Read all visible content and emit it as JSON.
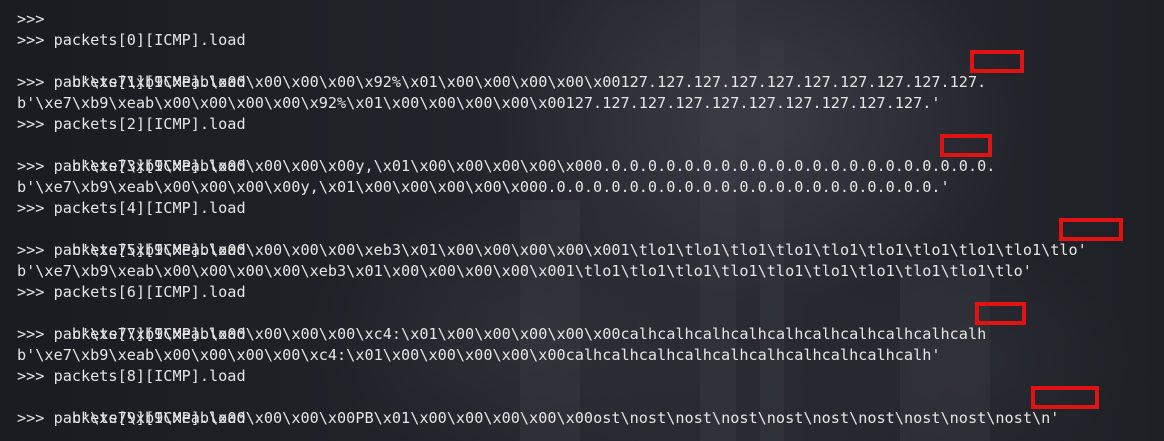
{
  "terminal": {
    "lines": [
      {
        "kind": "prompt",
        "text": ">>>"
      },
      {
        "kind": "prompt",
        "text": ">>> packets[0][ICMP].load"
      },
      {
        "kind": "output",
        "text": "b'\\xe7\\xb9\\xeab\\x00\\x00\\x00\\x00\\x92%\\x01\\x00\\x00\\x00\\x00\\x00127.127.127.127.127.127.127.127.127.127."
      },
      {
        "kind": "prompt",
        "text": ">>> packets[1][ICMP].load"
      },
      {
        "kind": "output",
        "text": "b'\\xe7\\xb9\\xeab\\x00\\x00\\x00\\x00\\x92%\\x01\\x00\\x00\\x00\\x00\\x00127.127.127.127.127.127.127.127.127.127.'"
      },
      {
        "kind": "prompt",
        "text": ">>> packets[2][ICMP].load"
      },
      {
        "kind": "output",
        "text": "b'\\xe7\\xb9\\xeab\\x00\\x00\\x00\\x00y,\\x01\\x00\\x00\\x00\\x00\\x000.0.0.0.0.0.0.0.0.0.0.0.0.0.0.0.0.0.0.0.0.0."
      },
      {
        "kind": "prompt",
        "text": ">>> packets[3][ICMP].load"
      },
      {
        "kind": "output",
        "text": "b'\\xe7\\xb9\\xeab\\x00\\x00\\x00\\x00y,\\x01\\x00\\x00\\x00\\x00\\x000.0.0.0.0.0.0.0.0.0.0.0.0.0.0.0.0.0.0.0.0.0.'"
      },
      {
        "kind": "prompt",
        "text": ">>> packets[4][ICMP].load"
      },
      {
        "kind": "output",
        "text": "b'\\xe7\\xb9\\xeab\\x00\\x00\\x00\\x00\\xeb3\\x01\\x00\\x00\\x00\\x00\\x001\\tlo1\\tlo1\\tlo1\\tlo1\\tlo1\\tlo1\\tlo1\\tlo1\\tlo1\\tlo'"
      },
      {
        "kind": "prompt",
        "text": ">>> packets[5][ICMP].load"
      },
      {
        "kind": "output",
        "text": "b'\\xe7\\xb9\\xeab\\x00\\x00\\x00\\x00\\xeb3\\x01\\x00\\x00\\x00\\x00\\x001\\tlo1\\tlo1\\tlo1\\tlo1\\tlo1\\tlo1\\tlo1\\tlo1\\tlo1\\tlo'"
      },
      {
        "kind": "prompt",
        "text": ">>> packets[6][ICMP].load"
      },
      {
        "kind": "output",
        "text": "b'\\xe7\\xb9\\xeab\\x00\\x00\\x00\\x00\\xc4:\\x01\\x00\\x00\\x00\\x00\\x00calhcalhcalhcalhcalhcalhcalhcalhcalhcalh"
      },
      {
        "kind": "prompt",
        "text": ">>> packets[7][ICMP].load"
      },
      {
        "kind": "output",
        "text": "b'\\xe7\\xb9\\xeab\\x00\\x00\\x00\\x00\\xc4:\\x01\\x00\\x00\\x00\\x00\\x00calhcalhcalhcalhcalhcalhcalhcalhcalhcalh'"
      },
      {
        "kind": "prompt",
        "text": ">>> packets[8][ICMP].load"
      },
      {
        "kind": "output",
        "text": "b'\\xe7\\xb9\\xeab\\x00\\x00\\x00\\x00PB\\x01\\x00\\x00\\x00\\x00\\x00ost\\nost\\nost\\nost\\nost\\nost\\nost\\nost\\nost\\nost\\n'"
      },
      {
        "kind": "prompt",
        "text": ">>> packets[9][ICMP].load"
      }
    ]
  },
  "highlight_color": "#e01212",
  "text_color": "#e6e6e6",
  "background_color": "#1d1e24"
}
